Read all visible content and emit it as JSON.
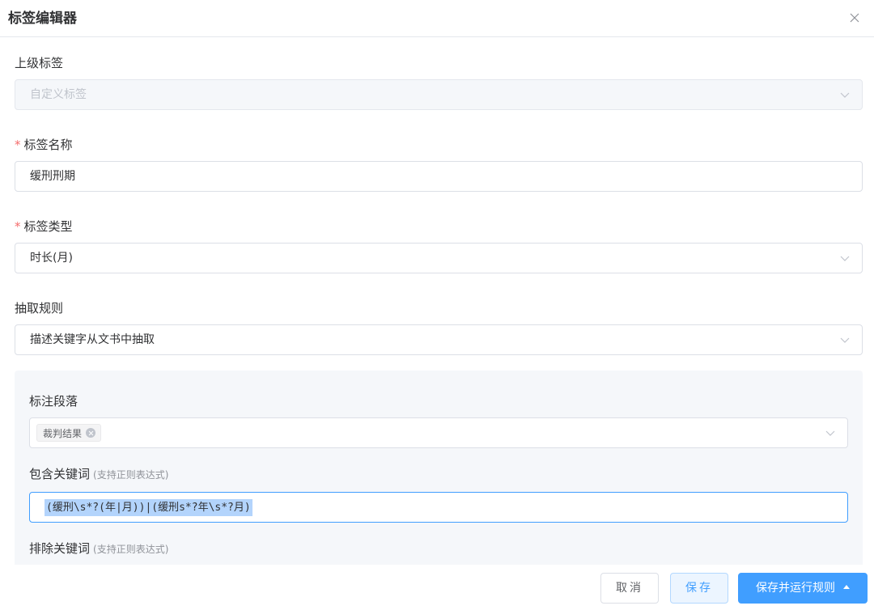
{
  "dialog": {
    "title": "标签编辑器",
    "close_icon": "close-icon"
  },
  "form": {
    "parent_tag": {
      "label": "上级标签",
      "value": "自定义标签",
      "disabled": true
    },
    "tag_name": {
      "required_mark": "*",
      "label": "标签名称",
      "value": "缓刑刑期"
    },
    "tag_type": {
      "required_mark": "*",
      "label": "标签类型",
      "value": "时长(月)"
    },
    "extract_rule": {
      "label": "抽取规则",
      "value": "描述关键字从文书中抽取"
    },
    "rule_panel": {
      "paragraph": {
        "label": "标注段落",
        "tags": [
          "裁判结果"
        ]
      },
      "include_keywords": {
        "label": "包含关键词",
        "hint": "(支持正则表达式)",
        "value": "(缓刑\\s*?(年|月))|(缓刑s*?年\\s*?月)"
      },
      "exclude_keywords": {
        "label": "排除关键词",
        "hint": "(支持正则表达式)"
      }
    }
  },
  "footer": {
    "cancel_label": "取消",
    "save_label": "保存",
    "save_run_label": "保存并运行规则"
  },
  "colors": {
    "primary": "#409eff",
    "required": "#f56c6c",
    "panel_bg": "#f5f7fa",
    "selection": "#b3d4fc"
  }
}
